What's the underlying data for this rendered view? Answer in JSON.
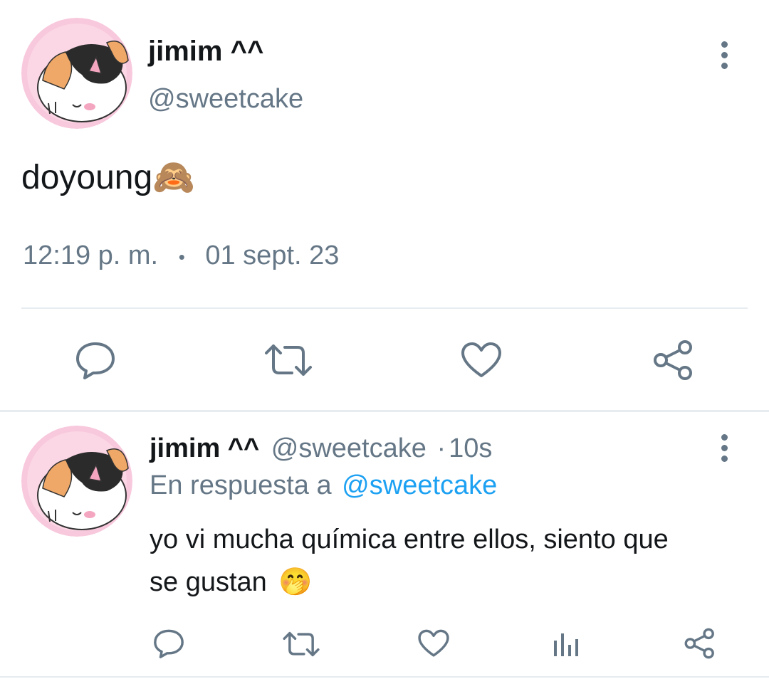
{
  "main_tweet": {
    "display_name": "jimim ^^",
    "handle": "@sweetcake",
    "text": "doyoung",
    "text_emoji": "🙈",
    "time": "12:19 p. m.",
    "separator": "•",
    "date": "01 sept. 23",
    "actions": [
      "reply-icon",
      "retweet-icon",
      "like-icon",
      "share-icon"
    ]
  },
  "reply_tweet": {
    "display_name": "jimim ^^",
    "handle": "@sweetcake",
    "dot": "·",
    "age": "10s",
    "replying_prefix": "En respuesta a",
    "replying_handle": "@sweetcake",
    "text_line1": "yo vi mucha química entre ellos, siento que",
    "text_line2": "se gustan",
    "text_emoji": "🤭",
    "actions": [
      "reply-icon",
      "retweet-icon",
      "like-icon",
      "analytics-icon",
      "share-icon"
    ]
  },
  "colors": {
    "text": "#14171a",
    "muted": "#657786",
    "link": "#1da1f2",
    "divider": "#e6ecf0",
    "avatar_bg": "#f8c8dc"
  }
}
